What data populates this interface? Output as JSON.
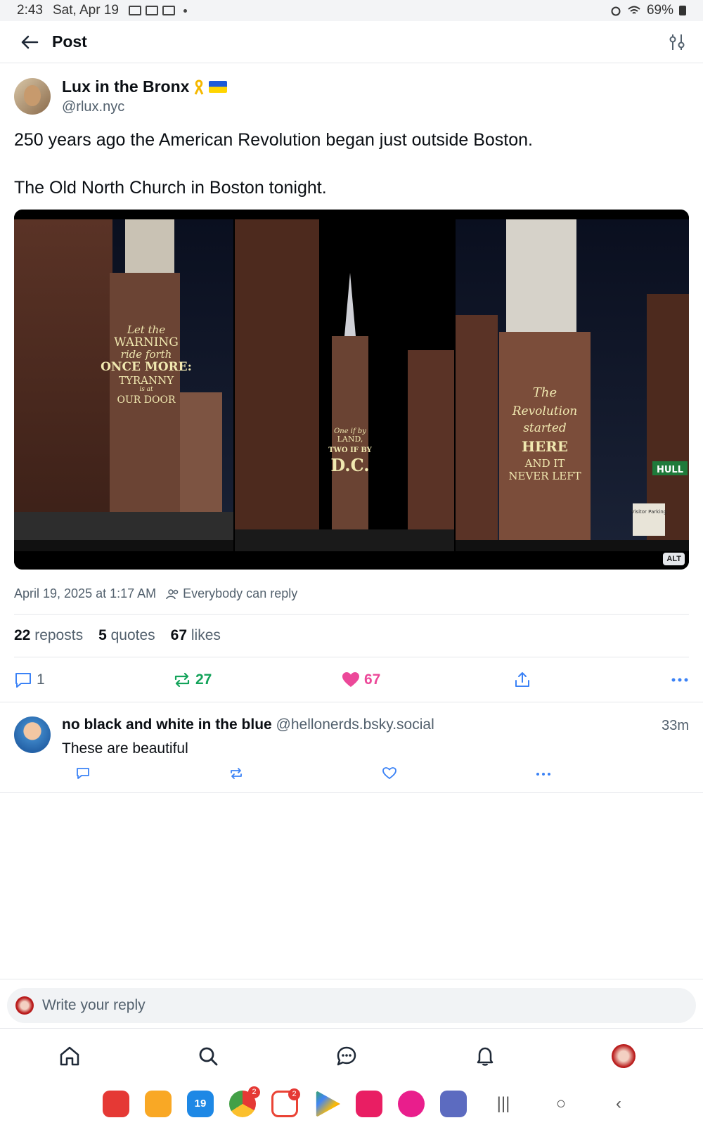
{
  "status_bar": {
    "time": "2:43",
    "date": "Sat, Apr 19",
    "battery": "69%"
  },
  "header": {
    "title": "Post"
  },
  "post": {
    "author_name": "Lux in the Bronx",
    "author_handle": "@rlux.nyc",
    "text": "250 years ago the American Revolution began just outside Boston.\n\nThe Old North Church in Boston tonight.",
    "image_captions": {
      "left": [
        "Let the",
        "WARNING",
        "ride forth",
        "ONCE MORE:",
        "TYRANNY",
        "is at",
        "OUR DOOR"
      ],
      "middle": [
        "One if by",
        "LAND,",
        "TWO IF BY",
        "D.C."
      ],
      "right": [
        "The",
        "Revolution",
        "started",
        "HERE",
        "AND IT",
        "NEVER LEFT"
      ],
      "street_sign": "HULL",
      "visitor_sign": "Visitor Parking"
    },
    "alt_badge": "ALT",
    "timestamp": "April 19, 2025 at 1:17 AM",
    "reply_setting": "Everybody can reply",
    "stats": {
      "reposts_count": "22",
      "reposts_label": "reposts",
      "quotes_count": "5",
      "quotes_label": "quotes",
      "likes_count": "67",
      "likes_label": "likes"
    },
    "actions": {
      "replies": "1",
      "reposts": "27",
      "likes": "67"
    }
  },
  "comment": {
    "author_name": "no black and white in the blue",
    "author_handle": "@hellonerds.bsky.social",
    "time": "33m",
    "text": "These are beautiful"
  },
  "reply_bar": {
    "placeholder": "Write your reply"
  },
  "dock": {
    "calendar_day": "19",
    "chrome_badge": "2",
    "gmail_badge": "2"
  },
  "colors": {
    "repost_green": "#13a35a",
    "like_pink": "#ec4899",
    "muted": "#52606d"
  }
}
